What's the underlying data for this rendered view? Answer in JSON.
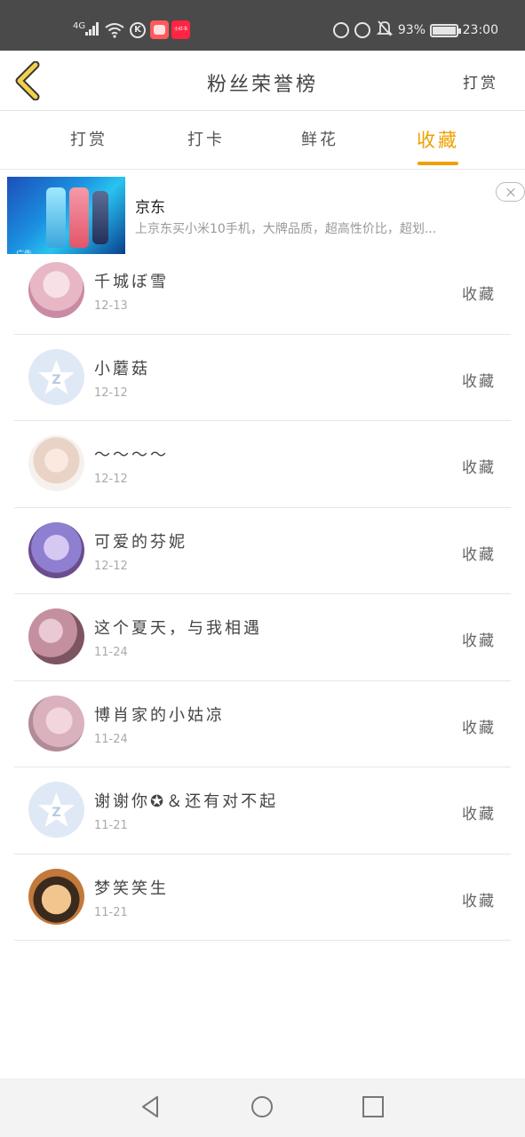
{
  "status_bar": {
    "network": "4G",
    "battery": "93%",
    "time": "23:00",
    "app2_label": "小红书"
  },
  "header": {
    "title": "粉丝荣誉榜",
    "action": "打赏"
  },
  "tabs": [
    {
      "label": "打赏",
      "active": false
    },
    {
      "label": "打卡",
      "active": false
    },
    {
      "label": "鲜花",
      "active": false
    },
    {
      "label": "收藏",
      "active": true
    }
  ],
  "ad": {
    "brand": "京东",
    "description": "上京东买小米10手机，大牌品质，超高性价比，超划...",
    "tag": "广告"
  },
  "fans": [
    {
      "name": "千城ぼ雪",
      "date": "12-13",
      "action": "收藏",
      "avatar": "pink-anime-avatar"
    },
    {
      "name": "小蘑菇",
      "date": "12-12",
      "action": "收藏",
      "avatar": "qq-default-avatar"
    },
    {
      "name": "～～～～",
      "date": "12-12",
      "action": "收藏",
      "avatar": "girl-avatar"
    },
    {
      "name": "可爱的芬妮",
      "date": "12-12",
      "action": "收藏",
      "avatar": "anime-avatar"
    },
    {
      "name": "这个夏天，与我相遇",
      "date": "11-24",
      "action": "收藏",
      "avatar": "blossom-avatar"
    },
    {
      "name": "博肖家的小姑凉",
      "date": "11-24",
      "action": "收藏",
      "avatar": "soft-portrait-avatar"
    },
    {
      "name": "谢谢你✪＆还有对不起",
      "date": "11-21",
      "action": "收藏",
      "avatar": "qq-default-avatar"
    },
    {
      "name": "梦笑笑生",
      "date": "11-21",
      "action": "收藏",
      "avatar": "luffy-avatar"
    }
  ],
  "colors": {
    "accent": "#f0a000",
    "status_bar_bg": "#4a4a4a",
    "back_arrow": "#f2d04a"
  }
}
